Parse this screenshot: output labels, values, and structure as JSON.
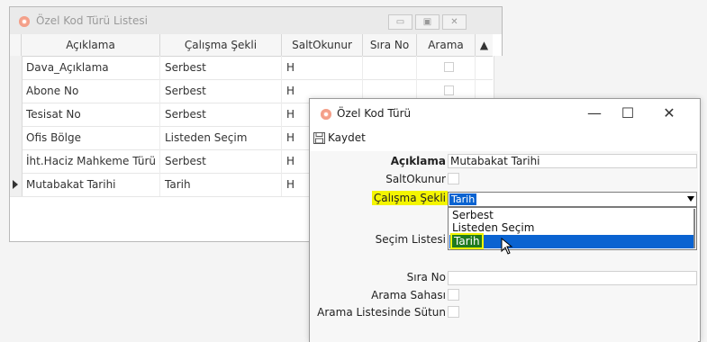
{
  "list_window": {
    "title": "Özel Kod Türü Listesi",
    "controls": [
      "minimize-icon",
      "maximize-icon",
      "close-icon"
    ],
    "columns": [
      "Açıklama",
      "Çalışma Şekli",
      "SaltOkunur",
      "Sıra No",
      "Arama"
    ],
    "rows": [
      {
        "aciklama": "Dava_Açıklama",
        "calisma": "Serbest",
        "salt": "H",
        "sira": "",
        "arama": false
      },
      {
        "aciklama": "Abone No",
        "calisma": "Serbest",
        "salt": "H",
        "sira": "",
        "arama": false
      },
      {
        "aciklama": "Tesisat No",
        "calisma": "Serbest",
        "salt": "H",
        "sira": "",
        "arama": false
      },
      {
        "aciklama": "Ofis Bölge",
        "calisma": "Listeden Seçim",
        "salt": "H",
        "sira": "",
        "arama": false
      },
      {
        "aciklama": "İht.Haciz Mahkeme Türü",
        "calisma": "Serbest",
        "salt": "H",
        "sira": "",
        "arama": false
      },
      {
        "aciklama": "Mutabakat Tarihi",
        "calisma": "Tarih",
        "salt": "H",
        "sira": "",
        "arama": false
      }
    ]
  },
  "edit_window": {
    "title": "Özel Kod Türü",
    "controls": {
      "minimize": "—",
      "maximize": "☐",
      "close": "✕"
    },
    "toolbar": {
      "save_label": "Kaydet"
    },
    "fields": {
      "aciklama_label": "Açıklama",
      "aciklama_value": "Mutabakat Tarihi",
      "saltokunur_label": "SaltOkunur",
      "calisma_label": "Çalışma Şekli",
      "calisma_value": "Tarih",
      "secim_label": "Seçim Listesi",
      "sira_label": "Sıra No",
      "arama_label": "Arama Sahası",
      "arama_sutun_label": "Arama Listesinde Sütun"
    },
    "dropdown_options": [
      "Serbest",
      "Listeden Seçim",
      "Tarih"
    ],
    "selected_option": "Tarih"
  },
  "colors": {
    "highlight": "#f4f500",
    "selection": "#0a63d1",
    "selected_option_bg": "#1f7a1f"
  }
}
